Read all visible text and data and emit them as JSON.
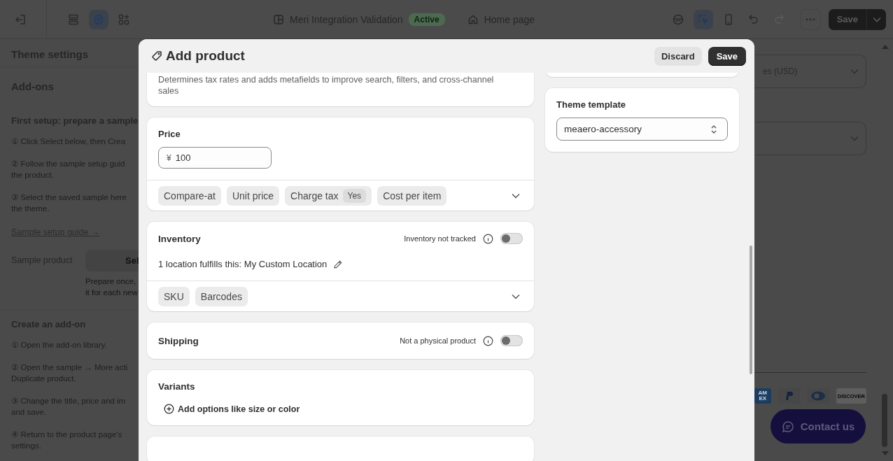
{
  "top_bar": {
    "left_tools": [
      {
        "kind": "exit",
        "selected": false
      },
      {
        "kind": "sections",
        "selected": false
      },
      {
        "kind": "gear",
        "selected": true
      },
      {
        "kind": "apps",
        "selected": false
      }
    ],
    "store_name": "Meri Integration Validation",
    "status": "Active",
    "page": "Home page",
    "right_tools": [
      {
        "kind": "mask",
        "selected": false,
        "disabled": false
      },
      {
        "kind": "pointer",
        "selected": true,
        "disabled": false
      },
      {
        "kind": "mobile",
        "selected": false,
        "disabled": false
      },
      {
        "kind": "undo",
        "selected": false,
        "disabled": false
      },
      {
        "kind": "redo",
        "selected": false,
        "disabled": true
      },
      {
        "kind": "more",
        "selected": false,
        "disabled": false
      }
    ],
    "save": "Save"
  },
  "sidebar": {
    "title": "Theme settings",
    "section": "Add-ons",
    "setup": {
      "heading": "First setup: prepare a sample",
      "steps": [
        [
          "① Click Select below, then Crea"
        ],
        [
          "② Follow the sample setup guid",
          "the product."
        ],
        [
          "③ Select the saved sample here",
          "the theme."
        ]
      ],
      "link": "Sample setup guide →",
      "field_label": "Sample product",
      "button": "Sel",
      "help": [
        "Prepare once,",
        "it for each new"
      ]
    },
    "addon": {
      "heading": "Create an add-on",
      "steps": [
        [
          "① Open the add-on library."
        ],
        [
          "② Open the sample → More acti",
          "Duplicate product."
        ],
        [
          "③ Change the title, price and im",
          "and save."
        ],
        [
          "④ Return to the product page's",
          "settings."
        ]
      ]
    }
  },
  "preview": {
    "currency": "es (USD)",
    "payments": [
      {
        "kind": "amex",
        "lines": [
          "AM",
          "EX"
        ]
      },
      {
        "kind": "paypal"
      },
      {
        "kind": "diners"
      },
      {
        "kind": "discover",
        "lines": [
          "DISCOVER"
        ]
      }
    ],
    "contact": "Contact us"
  },
  "modal": {
    "title": "Add product",
    "discard": "Discard",
    "save": "Save",
    "category_note": "Determines tax rates and adds metafields to improve search, filters, and cross-channel sales",
    "price": {
      "label": "Price",
      "currency": "¥",
      "value": "100",
      "chips": [
        {
          "label": "Compare-at"
        },
        {
          "label": "Unit price"
        },
        {
          "label": "Charge tax",
          "badge": "Yes"
        },
        {
          "label": "Cost per item"
        }
      ]
    },
    "inventory": {
      "title": "Inventory",
      "toggle_label": "Inventory not tracked",
      "on": false,
      "location": "1 location fulfills this: My Custom Location",
      "chips": [
        {
          "label": "SKU"
        },
        {
          "label": "Barcodes"
        }
      ]
    },
    "shipping": {
      "title": "Shipping",
      "toggle_label": "Not a physical product",
      "on": false
    },
    "variants": {
      "title": "Variants",
      "action": "Add options like size or color"
    },
    "theme_template": {
      "label": "Theme template",
      "value": "meaero-accessory"
    }
  }
}
